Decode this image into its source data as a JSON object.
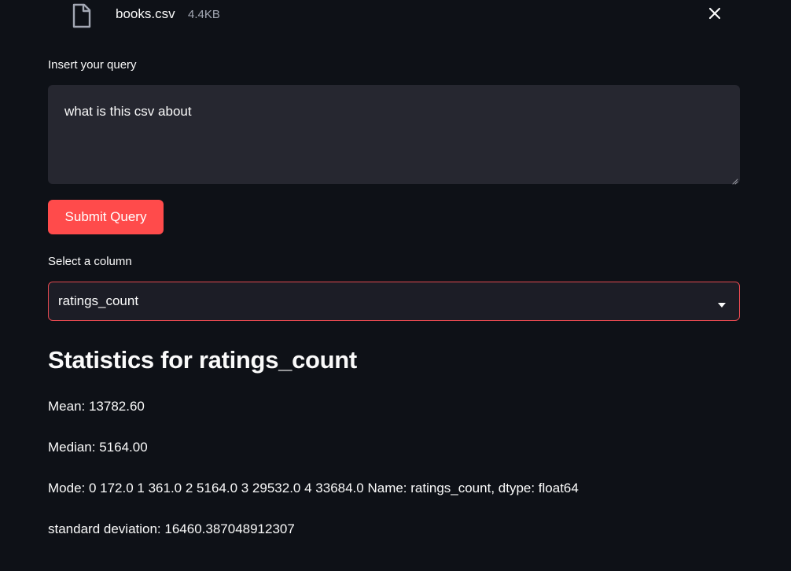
{
  "uploaded_file": {
    "icon": "file-icon",
    "name": "books.csv",
    "size": "4.4KB",
    "close_icon": "close-icon"
  },
  "query": {
    "label": "Insert your query",
    "value": "what is this csv about"
  },
  "submit": {
    "label": "Submit Query"
  },
  "column_select": {
    "label": "Select a column",
    "selected": "ratings_count",
    "arrow_icon": "chevron-down-icon"
  },
  "statistics": {
    "heading": "Statistics for ratings_count",
    "mean": "Mean: 13782.60",
    "median": "Median: 5164.00",
    "mode": "Mode: 0 172.0 1 361.0 2 5164.0 3 29532.0 4 33684.0 Name: ratings_count, dtype: float64",
    "std": "standard deviation: 16460.387048912307"
  },
  "colors": {
    "background": "#0e1117",
    "input_bg": "#262730",
    "primary": "#ff4b4b",
    "select_border": "#e0484f",
    "muted_text": "#a3a8b4"
  }
}
